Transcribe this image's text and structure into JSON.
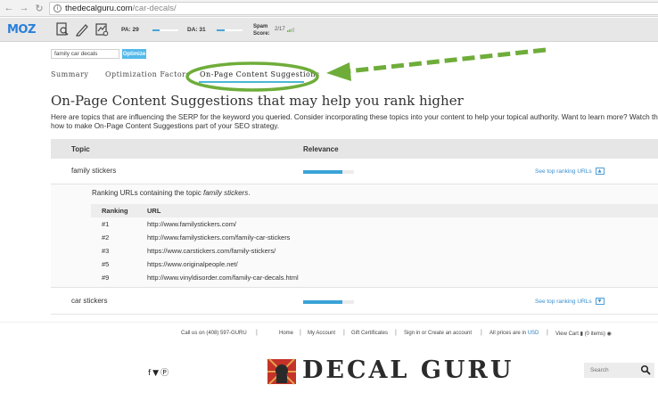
{
  "browser": {
    "url_host": "thedecalguru.com",
    "url_path": "/car-decals/"
  },
  "mozbar": {
    "logo": "MOZ",
    "pa_label": "PA: 29",
    "pa_value": 29,
    "da_label": "DA: 31",
    "da_value": 31,
    "spam_label_1": "Spam",
    "spam_label_2": "Score:",
    "spam_value": "2/17"
  },
  "keyword": {
    "value": "family car decals",
    "button": "Optimize"
  },
  "tabs": [
    {
      "label": "Summary"
    },
    {
      "label": "Optimization Factors"
    },
    {
      "label": "On-Page Content Suggestions",
      "active": true
    }
  ],
  "content": {
    "title": "On-Page Content Suggestions that may help you rank higher",
    "desc_line1": "Here are topics that are influencing the SERP for the keyword you queried. Consider incorporating these topics into your content to help your topical authority. Want to learn more? Watch this video on",
    "desc_line2": "how to make On-Page Content Suggestions part of your SEO strategy."
  },
  "table": {
    "col_topic": "Topic",
    "col_relevance": "Relevance",
    "rows": [
      {
        "topic": "family stickers",
        "relevance": 0.78,
        "link": "See top ranking URLs"
      },
      {
        "topic": "car stickers",
        "relevance": 0.78,
        "link": "See top ranking URLs"
      }
    ]
  },
  "ranking": {
    "caption_prefix": "Ranking URLs containing the topic ",
    "caption_topic": "family stickers",
    "caption_suffix": ".",
    "col_rank": "Ranking",
    "col_url": "URL",
    "rows": [
      {
        "rank": "#1",
        "url": "http://www.familystickers.com/"
      },
      {
        "rank": "#2",
        "url": "http://www.familystickers.com/family-car-stickers"
      },
      {
        "rank": "#3",
        "url": "https://www.carstickers.com/family-stickers/"
      },
      {
        "rank": "#5",
        "url": "https://www.originalpeople.net/"
      },
      {
        "rank": "#9",
        "url": "http://www.vinyldisorder.com/family-car-decals.html"
      }
    ]
  },
  "footer": {
    "call": "Call us on (408) 597-GURU",
    "home": "Home",
    "account": "My Account",
    "gift": "Gift Certificates",
    "signin": "Sign in or Create an account",
    "prices_prefix": "All prices are in",
    "currency": "USD",
    "cart": "View Cart",
    "items": "(0 items)",
    "social": "f ❤ ℗",
    "brand": "DECAL GURU",
    "search_placeholder": "Search"
  },
  "colors": {
    "accent": "#3aa3d6",
    "tab_underline": "#4bb8d4",
    "annotation_arrow": "#6fad3a"
  }
}
